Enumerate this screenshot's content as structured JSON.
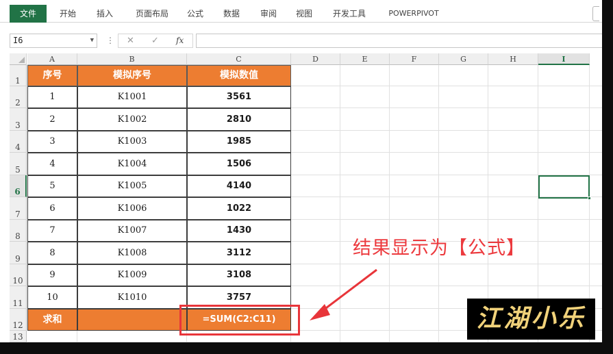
{
  "ribbon": {
    "tabs": [
      "文件",
      "开始",
      "插入",
      "页面布局",
      "公式",
      "数据",
      "审阅",
      "视图",
      "开发工具",
      "POWERPIVOT"
    ]
  },
  "formula_bar": {
    "name_box": "I6",
    "separator": "⋮",
    "cancel_icon": "✕",
    "enter_icon": "✓",
    "fx_label": "fx",
    "formula_value": ""
  },
  "columns": [
    "A",
    "B",
    "C",
    "D",
    "E",
    "F",
    "G",
    "H",
    "I"
  ],
  "rows": [
    "1",
    "2",
    "3",
    "4",
    "5",
    "6",
    "7",
    "8",
    "9",
    "10",
    "11",
    "12",
    "13"
  ],
  "selected_cell": "I6",
  "table": {
    "headers": [
      "序号",
      "模拟序号",
      "模拟数值"
    ],
    "rows": [
      [
        "1",
        "K1001",
        "3561"
      ],
      [
        "2",
        "K1002",
        "2810"
      ],
      [
        "3",
        "K1003",
        "1985"
      ],
      [
        "4",
        "K1004",
        "1506"
      ],
      [
        "5",
        "K1005",
        "4140"
      ],
      [
        "6",
        "K1006",
        "1022"
      ],
      [
        "7",
        "K1007",
        "1430"
      ],
      [
        "8",
        "K1008",
        "3112"
      ],
      [
        "9",
        "K1009",
        "3108"
      ],
      [
        "10",
        "K1010",
        "3757"
      ]
    ],
    "sum_label": "求和",
    "sum_formula": "=SUM(C2:C11)"
  },
  "annotation": {
    "text": "结果显示为【公式】",
    "color": "#ec3a3e"
  },
  "logo": {
    "text": "江湖小乐"
  },
  "colors": {
    "accent_green": "#217346",
    "header_orange": "#ed7d31",
    "highlight_red": "#e8353a"
  }
}
